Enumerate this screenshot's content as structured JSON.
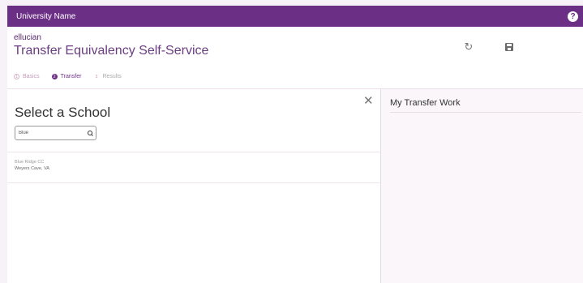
{
  "topbar": {
    "university_name": "University Name",
    "help_icon": "help-circle-icon",
    "color": "#6b2f86"
  },
  "header": {
    "brand": "ellucian",
    "title": "Transfer Equivalency Self-Service",
    "refresh_icon": "refresh-icon",
    "save_icon": "save-icon"
  },
  "steps": [
    {
      "marker": "1",
      "label": "Basics",
      "state": "complete"
    },
    {
      "marker": "2",
      "label": "Transfer",
      "state": "active"
    },
    {
      "marker": "3",
      "label": "Results",
      "state": "upcoming"
    }
  ],
  "school_panel": {
    "title": "Select a School",
    "search_value": "Blue",
    "results": [
      {
        "name": "Blue Ridge CC",
        "location": "Weyers Cave, VA"
      }
    ]
  },
  "transfer_panel": {
    "title": "My Transfer Work"
  }
}
